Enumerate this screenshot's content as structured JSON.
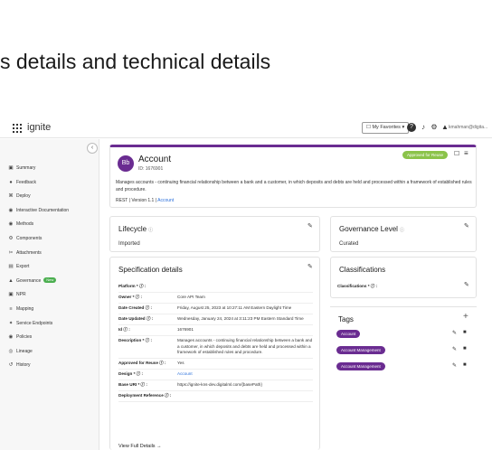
{
  "hero_text": "s details and technical details",
  "app": {
    "brand": "ignite",
    "favorites_label": "☐ My Favorites ▾",
    "user_email": "kmahman@digita...",
    "icons": {
      "help": "?",
      "bell": "♪",
      "gear": "⚙",
      "user": "▲"
    }
  },
  "sidebar": {
    "collapse": "‹",
    "items": [
      {
        "label": "Summary",
        "icon": "▣",
        "badge": ""
      },
      {
        "label": "Feedback",
        "icon": "●",
        "badge": ""
      },
      {
        "label": "Deploy",
        "icon": "⌘",
        "badge": ""
      },
      {
        "label": "Interactive Documentation",
        "icon": "◉",
        "badge": ""
      },
      {
        "label": "Methods",
        "icon": "◉",
        "badge": ""
      },
      {
        "label": "Components",
        "icon": "⚙",
        "badge": ""
      },
      {
        "label": "Attachments",
        "icon": "✂",
        "badge": ""
      },
      {
        "label": "Export",
        "icon": "▤",
        "badge": ""
      },
      {
        "label": "Governance",
        "icon": "▲",
        "badge": "New"
      },
      {
        "label": "NPR",
        "icon": "▣",
        "badge": ""
      },
      {
        "label": "Mapping",
        "icon": "≡",
        "badge": ""
      },
      {
        "label": "Service Endpoints",
        "icon": "✦",
        "badge": ""
      },
      {
        "label": "Policies",
        "icon": "◉",
        "badge": ""
      },
      {
        "label": "Lineage",
        "icon": "◎",
        "badge": ""
      },
      {
        "label": "History",
        "icon": "↺",
        "badge": ""
      }
    ]
  },
  "header_card": {
    "avatar": "Bb",
    "title": "Account",
    "id_text": "ID: 1676901",
    "status": "Approved for Reuse",
    "description": "Manages accounts - continuing financial relationship between a bank and a customer, in which deposits and debts are held and processed within a framework of established rules and procedure.",
    "meta_prefix": "REST | Version 1.1 | ",
    "meta_link": "Account"
  },
  "lifecycle": {
    "title": "Lifecycle",
    "info": "ⓘ",
    "value": "Imported"
  },
  "governance": {
    "title": "Governance Level",
    "info": "ⓘ",
    "value": "Curated"
  },
  "spec": {
    "title": "Specification details",
    "rows": [
      {
        "key": "Platform * ⓘ :",
        "value": ""
      },
      {
        "key": "Owner * ⓘ :",
        "value": "Core API Team"
      },
      {
        "key": "Date Created ⓘ :",
        "value": "Friday, August 25, 2023 at 10:27:11 AM Eastern Daylight Time"
      },
      {
        "key": "Date Updated ⓘ :",
        "value": "Wednesday, January 24, 2024 at 3:11:23 PM Eastern Standard Time"
      },
      {
        "key": "Id ⓘ :",
        "value": "1676901"
      },
      {
        "key": "Description * ⓘ :",
        "value": "Manages accounts - continuing financial relationship between a bank and a customer, in which deposits and debts are held and processed within a framework of established rules and procedure."
      },
      {
        "key": "Approved for Reuse ⓘ :",
        "value": "Yes"
      },
      {
        "key": "Design * ⓘ :",
        "value": "Account"
      },
      {
        "key": "Base URI * ⓘ :",
        "value": "https://ignite-kns-dev.digitalml.com/{basePath}"
      },
      {
        "key": "Deployment Reference ⓘ :",
        "value": ""
      }
    ],
    "view_more": "View Full Details →"
  },
  "classifications": {
    "title": "Classifications",
    "label": "Classifications * ⓘ :"
  },
  "tags": {
    "title": "Tags",
    "plus": "+",
    "items": [
      "Account",
      "Account Management",
      "Account Management"
    ]
  },
  "colors": {
    "brand_purple": "#6a2c91",
    "approved_green": "#8bc34a",
    "new_badge": "#4caf50",
    "link_blue": "#2a6fdb"
  }
}
